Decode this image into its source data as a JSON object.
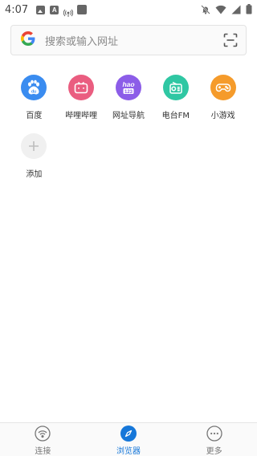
{
  "status_bar": {
    "time": "4:07",
    "icons_left": [
      "image-icon",
      "a-icon",
      "hotspot-icon",
      "app-square-icon"
    ],
    "icons_right": [
      "bell-off-icon",
      "wifi-icon",
      "signal-icon",
      "battery-icon"
    ]
  },
  "search": {
    "placeholder": "搜索或输入网址",
    "logo": "google-g-logo",
    "scan_icon": "scan-icon"
  },
  "shortcuts": [
    {
      "label": "百度",
      "icon": "baidu-paw-icon",
      "color": "#3a8cf0"
    },
    {
      "label": "哔哩哔哩",
      "icon": "bilibili-tv-icon",
      "color": "#ea5d80"
    },
    {
      "label": "网址导航",
      "icon": "hao123-icon",
      "color": "#8c5de8"
    },
    {
      "label": "电台FM",
      "icon": "radio-icon",
      "color": "#2fc7a3"
    },
    {
      "label": "小游戏",
      "icon": "gamepad-icon",
      "color": "#f59b2b"
    },
    {
      "label": "添加",
      "icon": "plus-icon",
      "color": "#f0f0f0"
    }
  ],
  "bottom_nav": [
    {
      "label": "连接",
      "icon": "wifi-connect-icon",
      "active": false
    },
    {
      "label": "浏览器",
      "icon": "compass-icon",
      "active": true
    },
    {
      "label": "更多",
      "icon": "more-dots-icon",
      "active": false
    }
  ],
  "colors": {
    "accent": "#1677d9",
    "nav_inactive": "#777777"
  }
}
